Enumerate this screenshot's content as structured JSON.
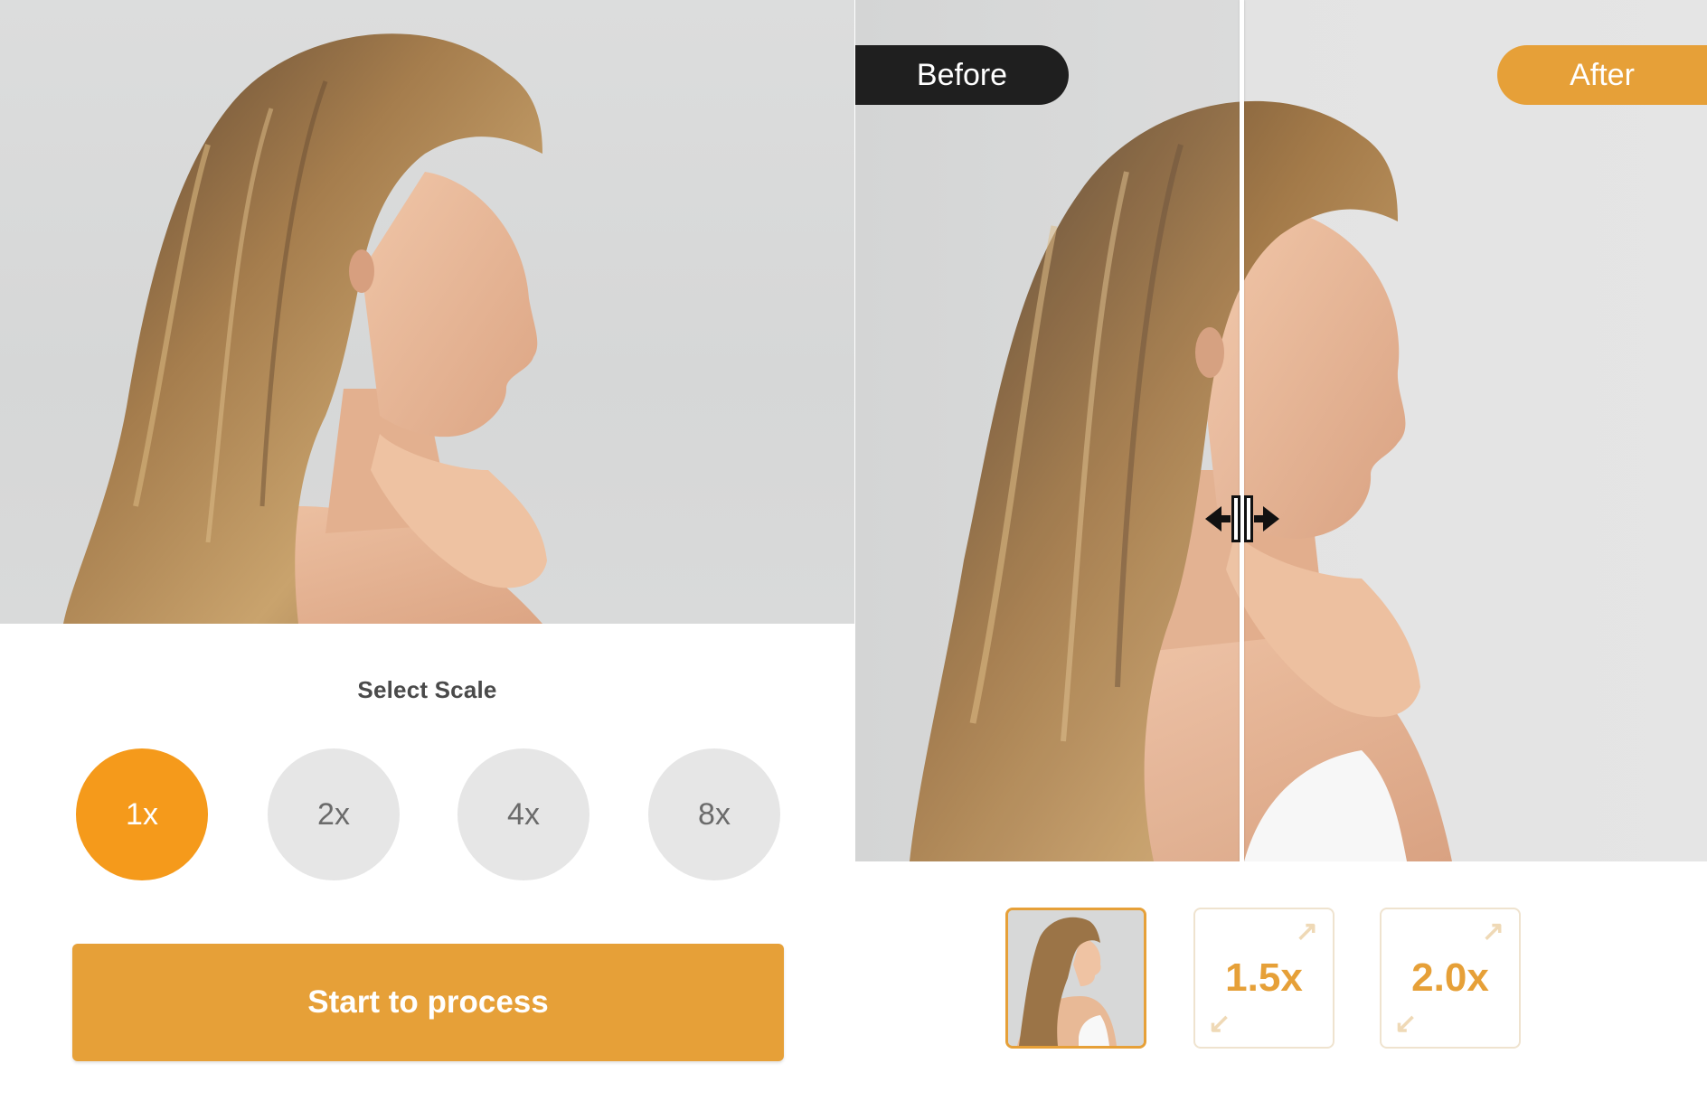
{
  "left": {
    "scale_title": "Select Scale",
    "scales": [
      {
        "label": "1x",
        "selected": true
      },
      {
        "label": "2x",
        "selected": false
      },
      {
        "label": "4x",
        "selected": false
      },
      {
        "label": "8x",
        "selected": false
      }
    ],
    "start_button": "Start to process"
  },
  "right": {
    "before_label": "Before",
    "after_label": "After",
    "zoom_options": [
      {
        "label": "1.5x"
      },
      {
        "label": "2.0x"
      }
    ]
  },
  "colors": {
    "accent_orange": "#e6a038",
    "selected_scale": "#f59a1b",
    "before_badge": "#1f1f1f",
    "unselected_scale": "#e6e6e6"
  },
  "icons": {
    "divider_handle": "drag-arrows-icon",
    "zoom_corner": "expand-arrows-icon"
  }
}
